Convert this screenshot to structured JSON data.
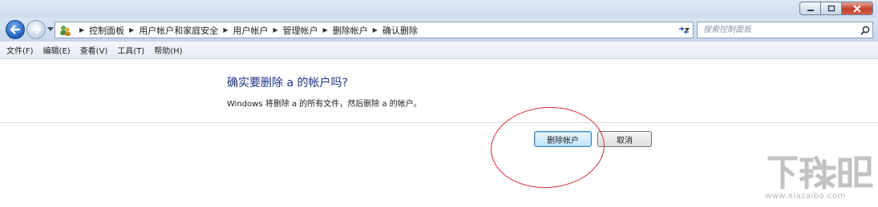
{
  "window": {
    "controls": [
      "minimize-icon",
      "maximize-icon",
      "close-icon"
    ]
  },
  "nav": {
    "breadcrumbs": [
      "控制面板",
      "用户帐户和家庭安全",
      "用户帐户",
      "管理帐户",
      "删除帐户",
      "确认删除"
    ],
    "search_placeholder": "搜索控制面板"
  },
  "menu": {
    "items": [
      "文件(F)",
      "编辑(E)",
      "查看(V)",
      "工具(T)",
      "帮助(H)"
    ]
  },
  "dialog": {
    "question": "确实要删除 a 的帐户吗?",
    "explanation": "Windows 将删除 a 的所有文件，然后删除 a 的帐户。",
    "delete_label": "删除帐户",
    "cancel_label": "取消"
  },
  "watermark": {
    "logo_text": "下载吧",
    "domain": "www.xiazaiba.com"
  },
  "colors": {
    "heading": "#1e3287",
    "annotation": "#d9303a",
    "chrome": "#cfdcec"
  }
}
